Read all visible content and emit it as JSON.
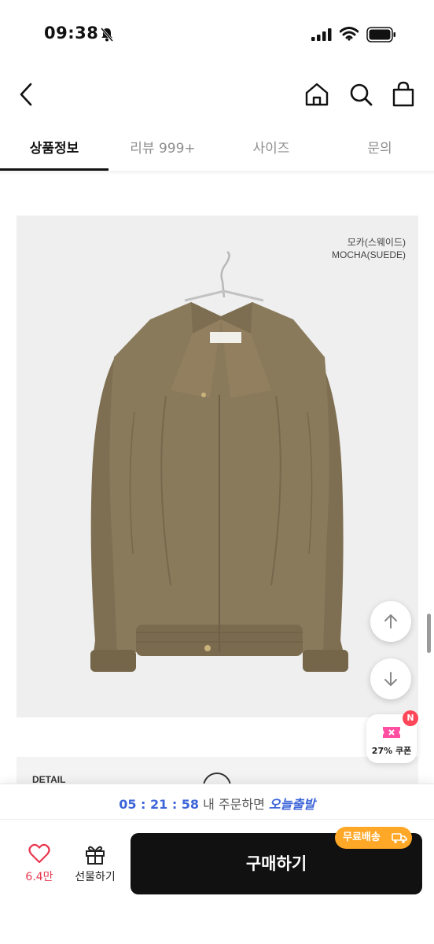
{
  "status_bar": {
    "time": "09:38"
  },
  "tabs": [
    {
      "label": "상품정보",
      "active": true
    },
    {
      "label": "리뷰 999+",
      "active": false
    },
    {
      "label": "사이즈",
      "active": false
    },
    {
      "label": "문의",
      "active": false
    }
  ],
  "product": {
    "color_name_ko": "모카(스웨이드)",
    "color_name_en": "MOCHA(SUEDE)",
    "detail_label": "DETAIL"
  },
  "coupon": {
    "label": "27% 쿠폰",
    "badge": "N"
  },
  "delivery": {
    "countdown": "05 : 21 : 58",
    "middle_text": " 내 주문하면 ",
    "badge_text": "오늘출발"
  },
  "bottom": {
    "like_count": "6.4만",
    "gift_label": "선물하기",
    "buy_label": "구매하기",
    "free_shipping_label": "무료배송"
  },
  "colors": {
    "accent_blue": "#3e66d9",
    "like_red": "#e8384f",
    "buy_button": "#111111",
    "free_shipping": "#ffa726",
    "coupon_pink": "#ff4fa0",
    "jacket_brown": "#8a7a5c"
  }
}
